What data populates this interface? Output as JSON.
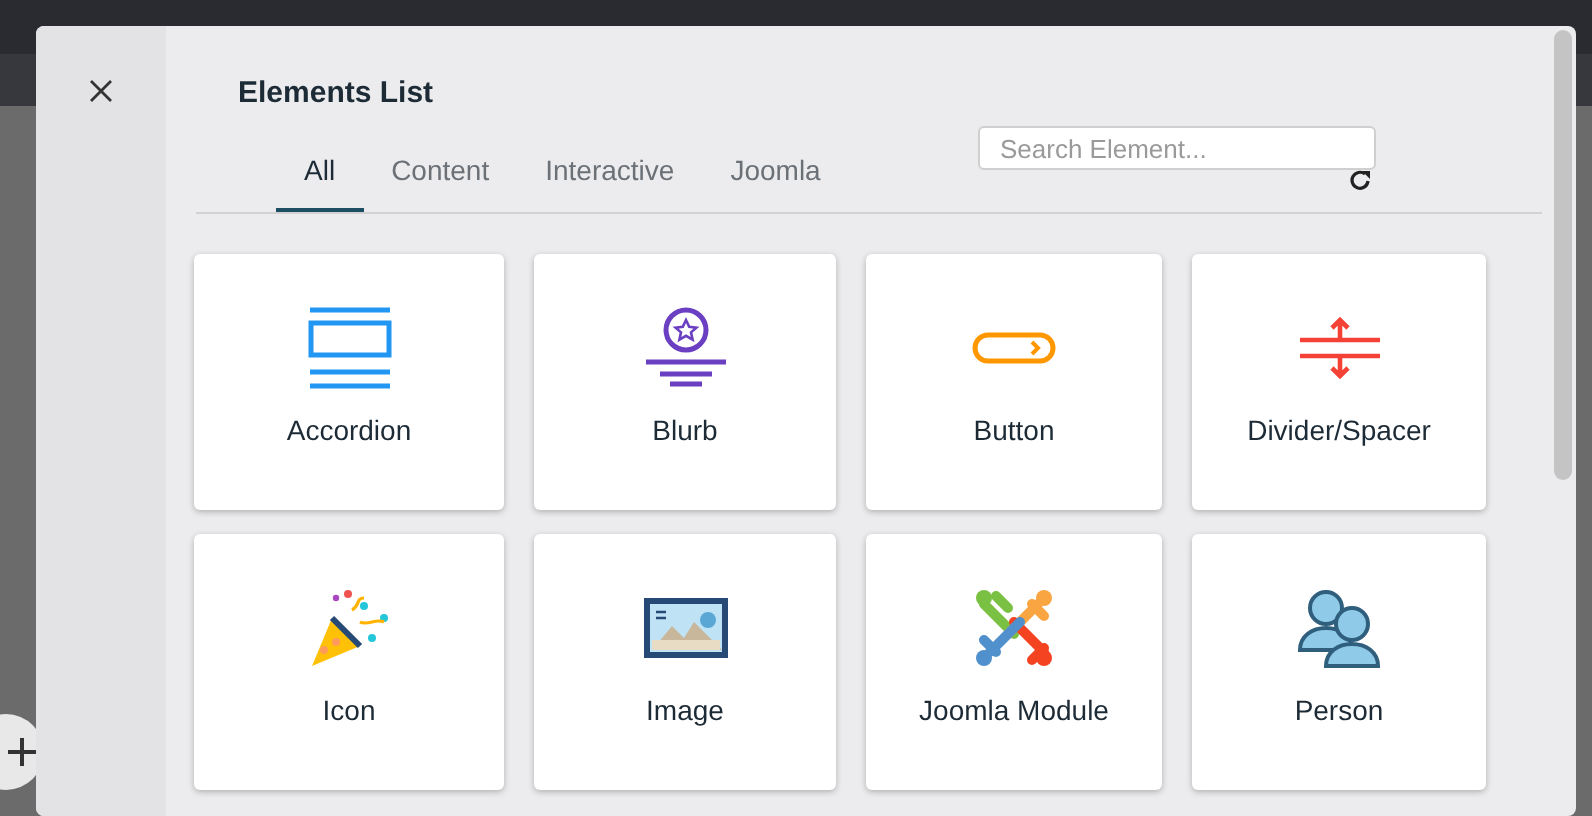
{
  "dialog": {
    "title": "Elements List"
  },
  "tabs": [
    {
      "label": "All",
      "selected": true
    },
    {
      "label": "Content",
      "selected": false
    },
    {
      "label": "Interactive",
      "selected": false
    },
    {
      "label": "Joomla",
      "selected": false
    }
  ],
  "search": {
    "placeholder": "Search Element..."
  },
  "elements": [
    {
      "label": "Accordion",
      "kind": "accordion"
    },
    {
      "label": "Blurb",
      "kind": "blurb"
    },
    {
      "label": "Button",
      "kind": "button"
    },
    {
      "label": "Divider/Spacer",
      "kind": "divider"
    },
    {
      "label": "Icon",
      "kind": "icon"
    },
    {
      "label": "Image",
      "kind": "image"
    },
    {
      "label": "Joomla Module",
      "kind": "module"
    },
    {
      "label": "Person",
      "kind": "person"
    }
  ]
}
